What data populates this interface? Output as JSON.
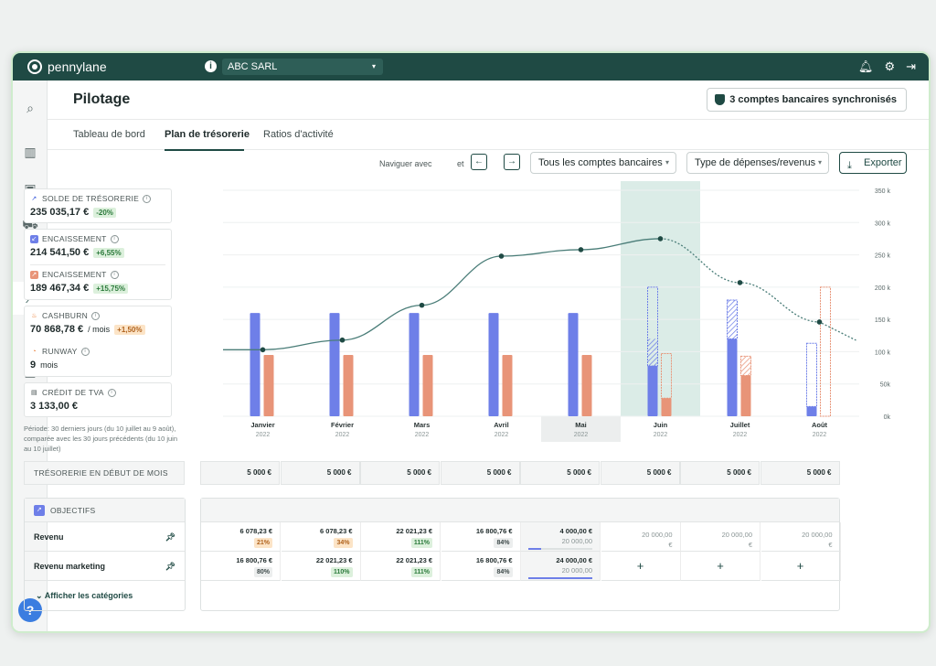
{
  "app": {
    "name": "pennylane",
    "company": "ABC SARL"
  },
  "page": {
    "title": "Pilotage",
    "sync_label": "3 comptes bancaires synchronisés"
  },
  "tabs": [
    {
      "label": "Tableau de bord",
      "active": false
    },
    {
      "label": "Plan de trésorerie",
      "active": true
    },
    {
      "label": "Ratios d'activité",
      "active": false
    }
  ],
  "toolbar": {
    "navigate_label": "Naviguer avec",
    "and_label": "et",
    "accounts_select": "Tous les comptes bancaires",
    "type_select": "Type de dépenses/revenus",
    "export_label": "Exporter"
  },
  "kpis": {
    "solde": {
      "label": "SOLDE DE TRÉSORERIE",
      "value": "235 035,17 €",
      "badge": "-20%"
    },
    "encaissement_in": {
      "label": "ENCAISSEMENT",
      "value": "214 541,50 €",
      "badge": "+6,55%"
    },
    "encaissement_out": {
      "label": "ENCAISSEMENT",
      "value": "189 467,34 €",
      "badge": "+15,75%"
    },
    "cashburn": {
      "label": "CASHBURN",
      "value": "70 868,78 €",
      "unit": "/ mois",
      "badge": "+1,50%"
    },
    "runway": {
      "label": "RUNWAY",
      "value": "9",
      "unit": "mois"
    },
    "tva": {
      "label": "CRÉDIT DE TVA",
      "value": "3 133,00 €"
    }
  },
  "period_note": "Période: 30 derniers jours (du 10 juillet au 9 août), comparée avec les 30 jours précédents (du 10 juin au 10 juillet)",
  "chart_data": {
    "type": "bar",
    "categories": [
      "Janvier",
      "Février",
      "Mars",
      "Avril",
      "Mai",
      "Juin",
      "Juillet",
      "Août"
    ],
    "year": "2022",
    "yticks": [
      "350 k",
      "300 k",
      "250 k",
      "200 k",
      "150 k",
      "100 k",
      "50k",
      "0k"
    ],
    "ylim": [
      0,
      350000
    ],
    "series": [
      {
        "values": [
          160000,
          160000,
          160000,
          160000,
          160000,
          78000,
          120000,
          15000
        ],
        "color": "#6e7fe8"
      },
      {
        "values": [
          95000,
          95000,
          95000,
          95000,
          95000,
          28000,
          63000,
          0
        ],
        "color": "#e89478"
      }
    ],
    "forecast_blue": [
      null,
      null,
      null,
      null,
      null,
      200000,
      180000,
      113000
    ],
    "forecast_blue_mid": [
      null,
      null,
      null,
      null,
      null,
      120000,
      null,
      null
    ],
    "forecast_orange": [
      null,
      null,
      null,
      null,
      null,
      97000,
      93000,
      200000
    ],
    "line": [
      103000,
      118000,
      172000,
      248000,
      258000,
      275000,
      207000,
      146000
    ],
    "highlight_month": "Juin",
    "current_month": "Mai"
  },
  "treso": {
    "label": "TRÉSORERIE EN DÉBUT DE MOIS",
    "values": [
      "5 000 €",
      "5 000 €",
      "5 000 €",
      "5 000 €",
      "5 000 €",
      "5 000 €",
      "5 000 €",
      "5 000 €"
    ]
  },
  "objectifs": {
    "title": "OBJECTIFS",
    "rows": [
      {
        "label": "Revenu",
        "cells": [
          {
            "value": "6 078,23 €",
            "pct": "21%",
            "tone": "orange"
          },
          {
            "value": "6 078,23 €",
            "pct": "34%",
            "tone": "orange"
          },
          {
            "value": "22 021,23 €",
            "pct": "111%",
            "tone": "green"
          },
          {
            "value": "16 800,76 €",
            "pct": "84%",
            "tone": "gray"
          },
          {
            "value": "4 000,00 €",
            "target": "20 000,00",
            "progress": 0.2
          },
          {
            "future": "20 000,00",
            "currency": "€"
          },
          {
            "future": "20 000,00",
            "currency": "€"
          },
          {
            "future": "20 000,00",
            "currency": "€"
          }
        ]
      },
      {
        "label": "Revenu marketing",
        "cells": [
          {
            "value": "16 800,76 €",
            "pct": "80%",
            "tone": "gray"
          },
          {
            "value": "22 021,23 €",
            "pct": "110%",
            "tone": "green"
          },
          {
            "value": "22 021,23 €",
            "pct": "111%",
            "tone": "green"
          },
          {
            "value": "16 800,76 €",
            "pct": "84%",
            "tone": "gray"
          },
          {
            "value": "24 000,00 €",
            "target": "20 000,00",
            "progress": 1.0
          },
          {
            "plus": "+"
          },
          {
            "plus": "+"
          },
          {
            "plus": "+"
          }
        ]
      }
    ],
    "show_categories": "Afficher les catégories"
  }
}
